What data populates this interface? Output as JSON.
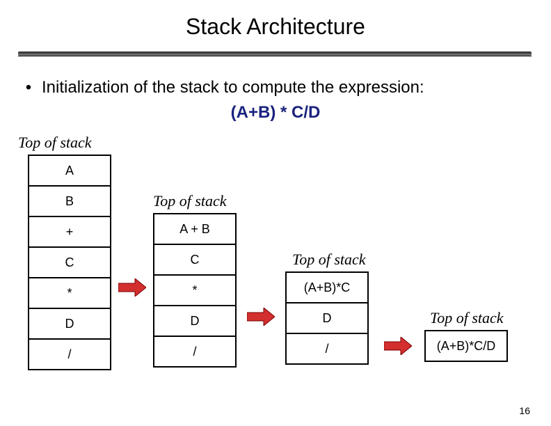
{
  "title": "Stack Architecture",
  "bullet": "Initialization of the stack to compute the expression:",
  "expression": "(A+B) * C/D",
  "tos_label": "Top of stack",
  "stacks": {
    "s1": [
      "A",
      "B",
      "+",
      "C",
      "*",
      "D",
      "/"
    ],
    "s2": [
      "A + B",
      "C",
      "*",
      "D",
      "/"
    ],
    "s3": [
      "(A+B)*C",
      "D",
      "/"
    ],
    "s4": [
      "(A+B)*C/D"
    ]
  },
  "page_number": "16",
  "icons": {
    "arrow": "right-red-block-arrow"
  }
}
